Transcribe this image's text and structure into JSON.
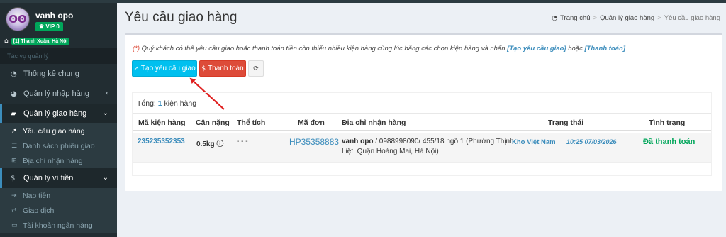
{
  "colors": {
    "sidebar": "#222d32",
    "accent": "#3c8dbc",
    "success": "#00a65a",
    "danger": "#dd4b39",
    "info": "#00c0ef"
  },
  "user": {
    "name": "vanh opo",
    "vip": "VIP 0",
    "location": "[1] Thanh Xuân, Hà Nội"
  },
  "sidebar": {
    "header": "Tác vụ quản lý",
    "items": [
      {
        "icon": "dashboard-icon",
        "label": "Thống kê chung"
      },
      {
        "icon": "pie-chart-icon",
        "label": "Quản lý nhập hàng",
        "chevron": "‹"
      },
      {
        "icon": "truck-icon",
        "label": "Quản lý giao hàng",
        "chevron": "⌄"
      },
      {
        "icon": "dollar-icon",
        "label": "Quản lý ví tiền",
        "chevron": "⌄"
      }
    ],
    "delivery_sub": [
      {
        "icon": "rocket-icon",
        "label": "Yêu cầu giao hàng"
      },
      {
        "icon": "list-icon",
        "label": "Danh sách phiếu giao"
      },
      {
        "icon": "sitemap-icon",
        "label": "Địa chỉ nhận hàng"
      }
    ],
    "wallet_sub": [
      {
        "icon": "sign-in-icon",
        "label": "Nạp tiền"
      },
      {
        "icon": "exchange-icon",
        "label": "Giao dịch"
      },
      {
        "icon": "card-icon",
        "label": "Tài khoản ngân hàng"
      }
    ]
  },
  "page": {
    "title": "Yêu cầu giao hàng"
  },
  "breadcrumb": {
    "home": "Trang chủ",
    "parent": "Quản lý giao hàng",
    "current": "Yêu cầu giao hàng"
  },
  "notice": {
    "star": "(*)",
    "text": " Quý khách có thể yêu cầu giao hoặc thanh toán tiền còn thiếu nhiều kiện hàng cùng lúc bằng các chọn kiện hàng và nhấn ",
    "link1": "[Tạo yêu cầu giao]",
    "mid": " hoặc ",
    "link2": "[Thanh toán]"
  },
  "buttons": {
    "create": "Tạo yêu cầu giao",
    "pay": "Thanh toán"
  },
  "summary": {
    "label": "Tổng: ",
    "count": "1",
    "unit": " kiện hàng"
  },
  "table": {
    "headers": [
      "Mã kiện hàng",
      "Cân nặng",
      "Thể tích",
      "Mã đơn",
      "Địa chỉ nhận hàng",
      "Trạng thái",
      "Tình trạng"
    ],
    "rows": [
      {
        "package_code": "235235352353",
        "weight": "0.5kg",
        "volume": "- - -",
        "order_code": "HP35358883",
        "recipient": "vanh opo",
        "address_line1": " / 0988998090/ 455/18 ngõ 1 (Phường Thịnh",
        "address_line2": "Liệt, Quận Hoàng Mai, Hà Nội)",
        "warehouse": "Kho Việt Nam",
        "datetime": "10:25 07/03/2026",
        "condition": "Đã thanh toán"
      }
    ]
  }
}
